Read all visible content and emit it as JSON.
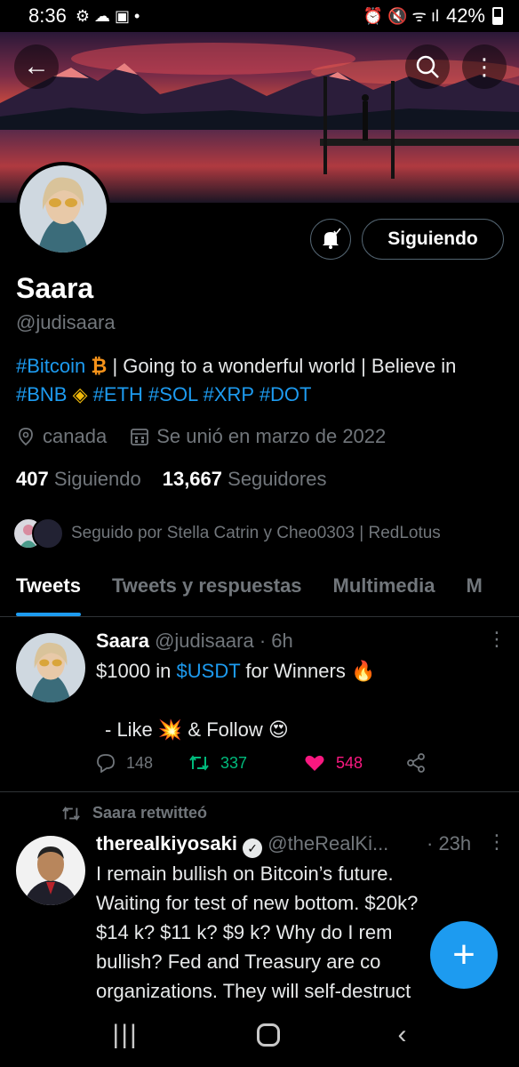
{
  "status_bar": {
    "time": "8:36",
    "battery": "42%"
  },
  "profile": {
    "name": "Saara",
    "handle": "@judisaara",
    "follow_label": "Siguiendo",
    "bio_parts": [
      "#Bitcoin",
      " | Going to a wonderful world | Believe in ",
      "#BNB",
      "#ETH",
      "#SOL",
      "#XRP",
      "#DOT"
    ],
    "location": "canada",
    "joined": "Se unió en marzo de 2022",
    "following_count": "407",
    "following_label": "Siguiendo",
    "followers_count": "13,667",
    "followers_label": "Seguidores",
    "followed_by": "Seguido por Stella Catrin y Cheo0303 | RedLotus"
  },
  "tabs": [
    "Tweets",
    "Tweets y respuestas",
    "Multimedia",
    "M"
  ],
  "tweets": [
    {
      "name": "Saara",
      "handle": "@judisaara",
      "time": "· 6h",
      "line1_pre": "$1000 in ",
      "line1_tag": "$USDT",
      "line1_post": " for Winners 🔥",
      "line2": " - Like 💥 & Follow 😍",
      "replies": "148",
      "retweets": "337",
      "likes": "548"
    },
    {
      "retweet_label": "Saara retwitteó",
      "name": "therealkiyosaki",
      "handle": "@theRealKi...",
      "time": "· 23h",
      "text_lines": [
        "I remain bullish on Bitcoin’s future.",
        "Waiting for test of new bottom. $20k?",
        "$14 k? $11 k?  $9 k?  Why do I rem",
        "bullish?  Fed and Treasury are co",
        "organizations. They will self-destruct"
      ]
    }
  ],
  "colors": {
    "accent": "#1d9bf0",
    "retweet": "#00ba7c",
    "like": "#f91880",
    "muted": "#71767b"
  },
  "icons": [
    "back-arrow-icon",
    "search-icon",
    "more-vertical-icon",
    "bell-icon",
    "location-icon",
    "calendar-icon",
    "reply-icon",
    "retweet-icon",
    "heart-icon",
    "share-icon",
    "plus-icon",
    "verified-icon"
  ]
}
